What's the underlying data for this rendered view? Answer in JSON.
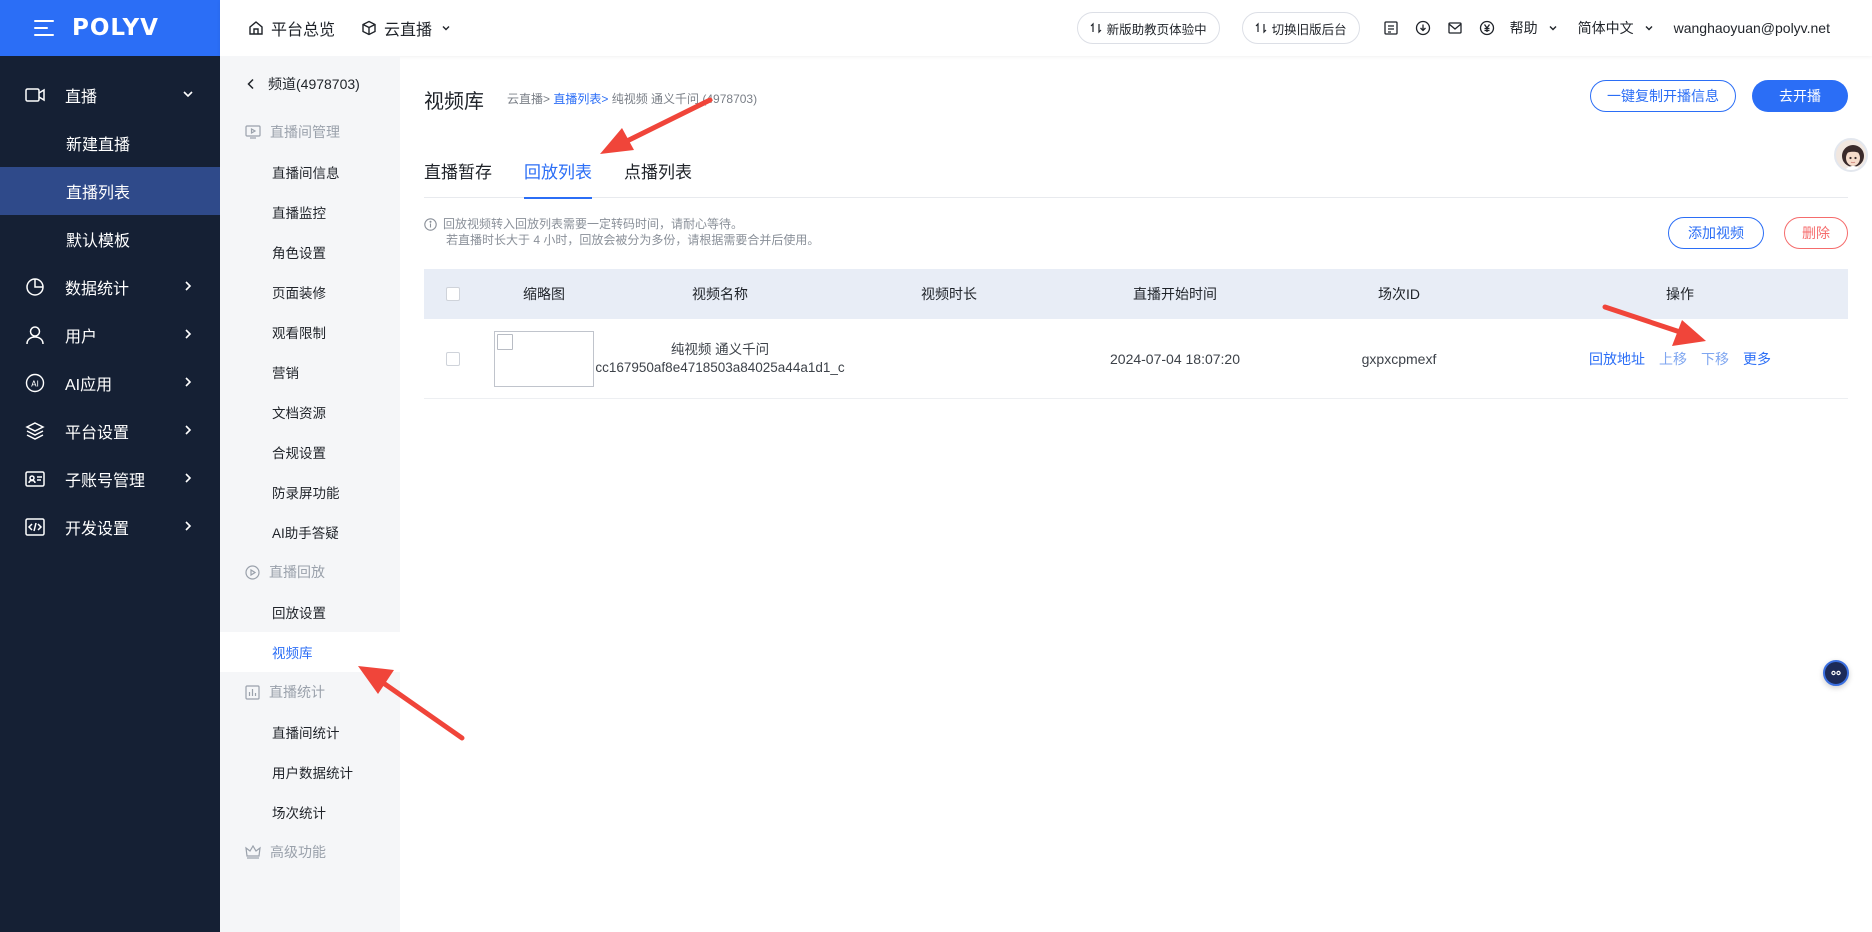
{
  "sidebar": {
    "logo": "POLYV",
    "items": [
      {
        "label": "直播",
        "icon": "live-camera-icon"
      },
      {
        "label": "数据统计",
        "icon": "pie-chart-icon"
      },
      {
        "label": "用户",
        "icon": "user-icon"
      },
      {
        "label": "AI应用",
        "icon": "ai-icon"
      },
      {
        "label": "平台设置",
        "icon": "layers-icon"
      },
      {
        "label": "子账号管理",
        "icon": "id-card-icon"
      },
      {
        "label": "开发设置",
        "icon": "code-icon"
      }
    ],
    "live_sub": [
      "新建直播",
      "直播列表",
      "默认模板"
    ]
  },
  "header": {
    "nav_home": "平台总览",
    "nav_cloud": "云直播",
    "pill_new": "新版助教页体验中",
    "pill_old": "切换旧版后台",
    "help": "帮助",
    "lang": "简体中文",
    "user": "wanghaoyuan@polyv.net"
  },
  "subnav": {
    "back": "频道(4978703)",
    "groups": [
      {
        "title": "直播间管理",
        "items": [
          "直播间信息",
          "直播监控",
          "角色设置",
          "页面装修",
          "观看限制",
          "营销",
          "文档资源",
          "合规设置",
          "防录屏功能",
          "AI助手答疑"
        ]
      },
      {
        "title": "直播回放",
        "items": [
          "回放设置",
          "视频库"
        ]
      },
      {
        "title": "直播统计",
        "items": [
          "直播间统计",
          "用户数据统计",
          "场次统计"
        ]
      },
      {
        "title": "高级功能",
        "items": []
      }
    ]
  },
  "main": {
    "title": "视频库",
    "crumb_1": "云直播>",
    "crumb_2": "直播列表>",
    "crumb_3": "纯视频 通义千问 (4978703)",
    "btn_copy": "一键复制开播信息",
    "btn_go": "去开播",
    "tabs": [
      "直播暂存",
      "回放列表",
      "点播列表"
    ],
    "notice_1": "回放视频转入回放列表需要一定转码时间，请耐心等待。",
    "notice_2": "若直播时长大于 4 小时，回放会被分为多份，请根据需要合并后使用。",
    "btn_add": "添加视频",
    "btn_delete": "删除"
  },
  "table": {
    "headers": [
      "缩略图",
      "视频名称",
      "视频时长",
      "直播开始时间",
      "场次ID",
      "操作"
    ],
    "rows": [
      {
        "name_1": "纯视频 通义千问",
        "name_2": "cc167950af8e4718503a84025a44a1d1_c",
        "duration": "",
        "start_time": "2024-07-04 18:07:20",
        "session_id": "gxpxcpmexf",
        "ops": [
          "回放地址",
          "上移",
          "下移",
          "更多"
        ]
      }
    ]
  },
  "colors": {
    "brand": "#2b6ef6",
    "sidebar": "#152034",
    "danger": "#f56c6c",
    "annotation_arrow": "#f0453a"
  }
}
